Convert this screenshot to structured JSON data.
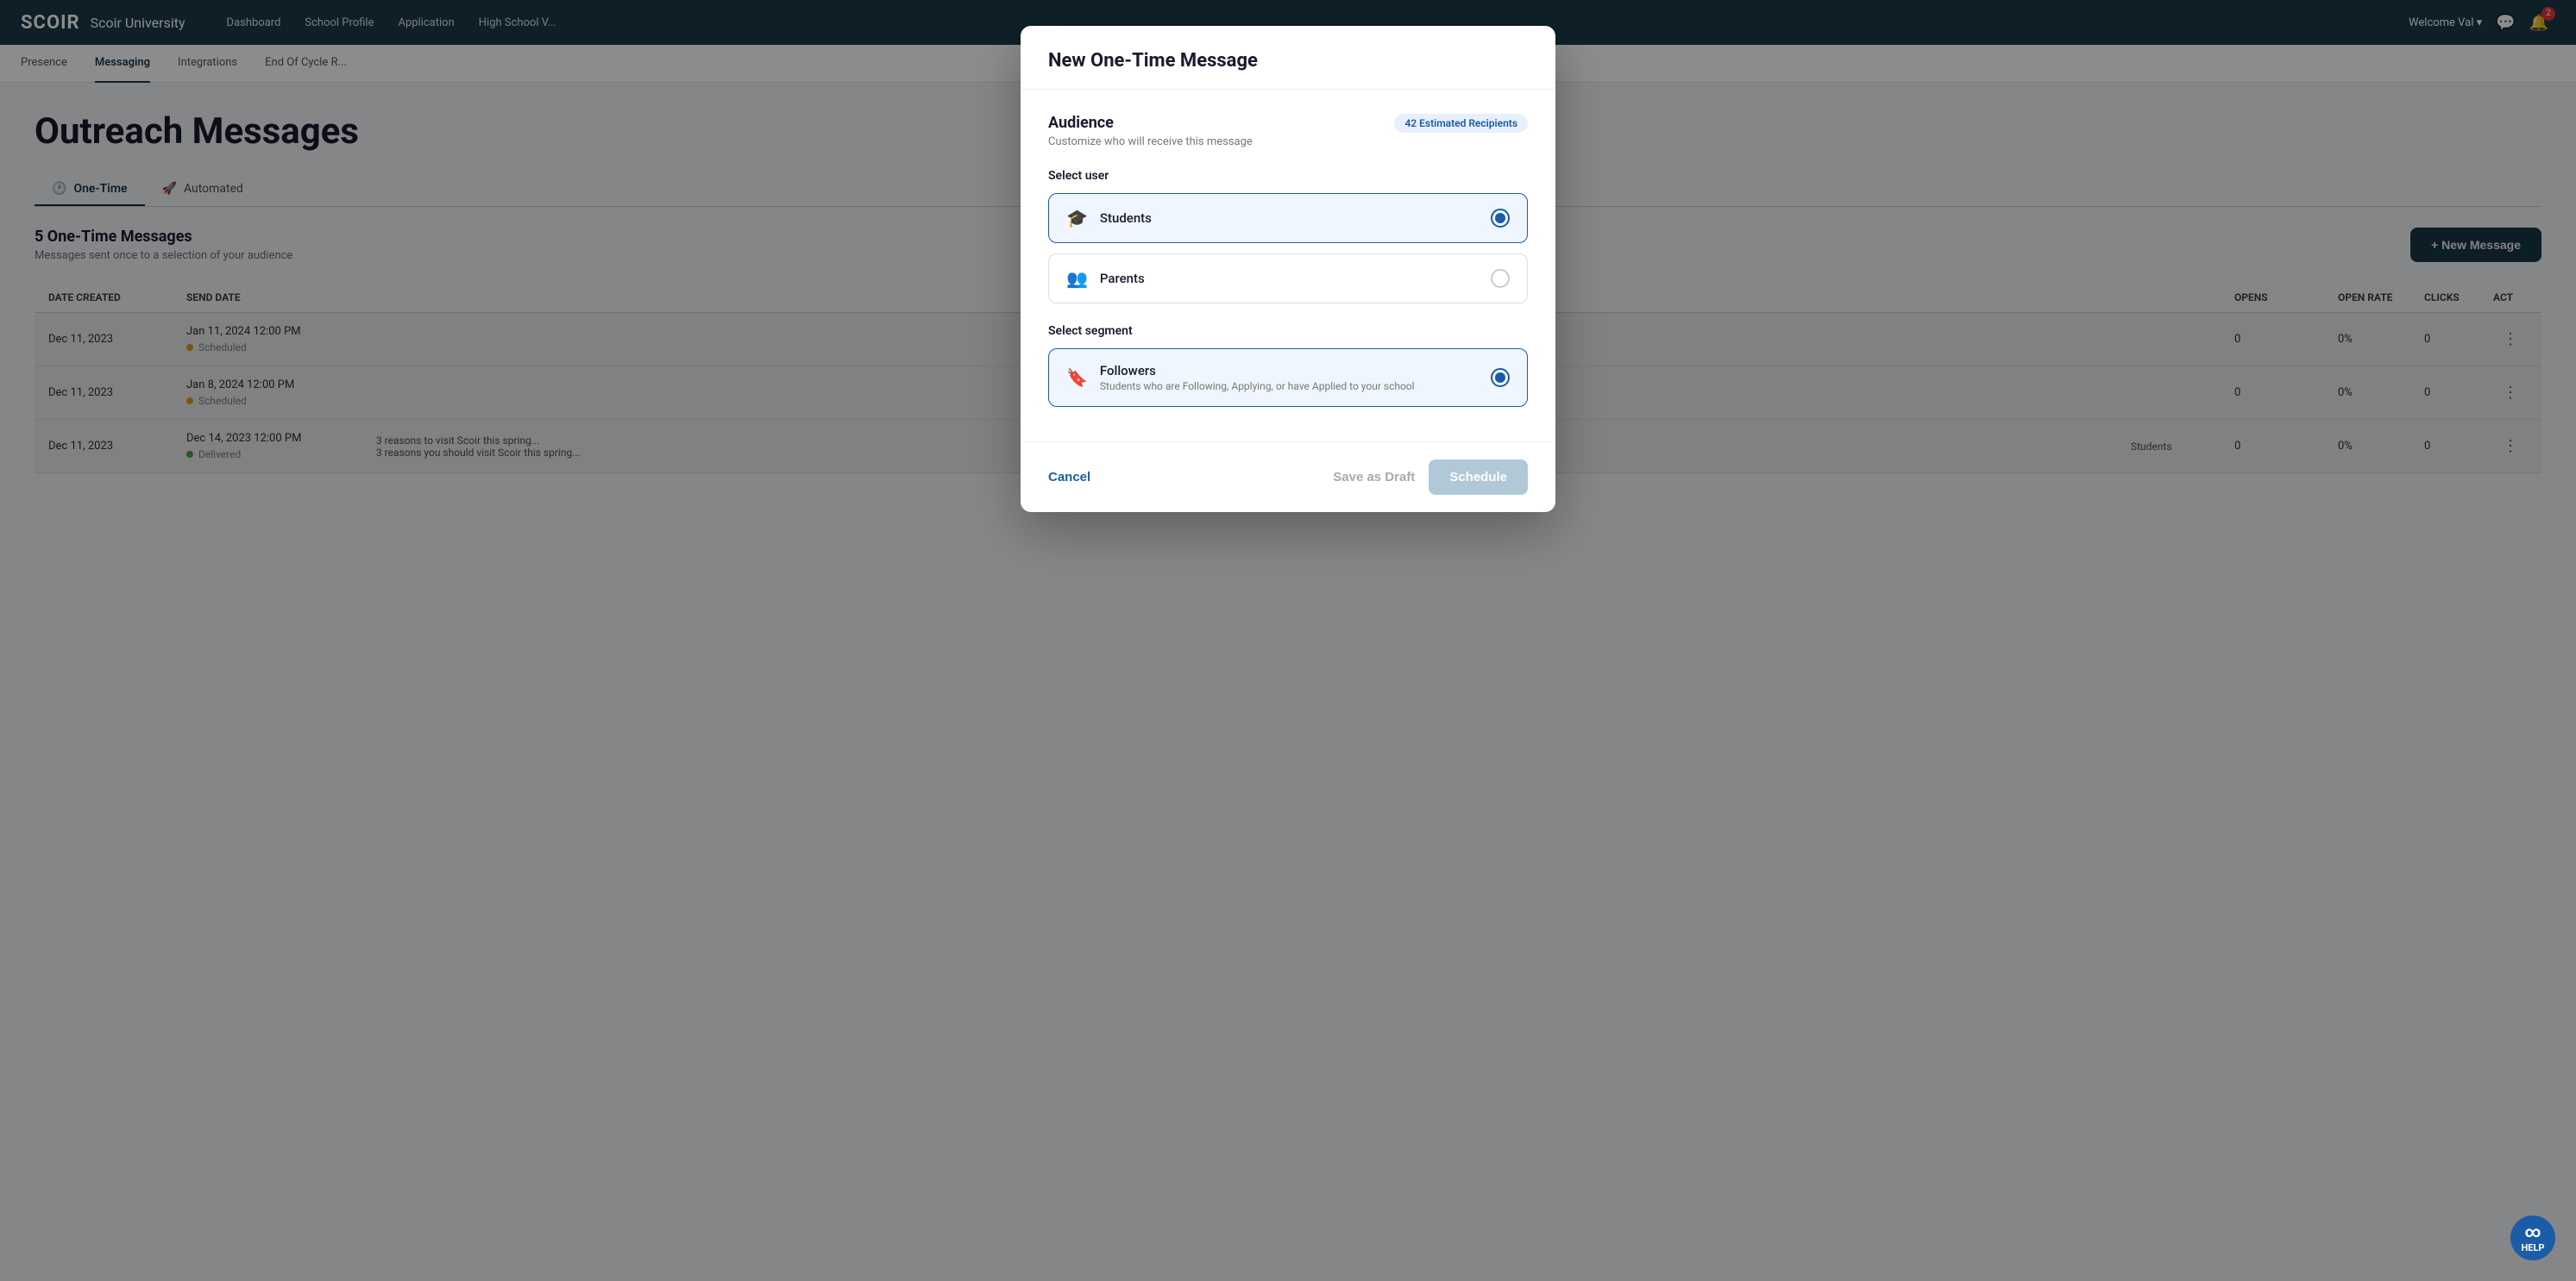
{
  "app": {
    "logo": "SCOIR",
    "school_name": "Scoir University"
  },
  "top_nav": {
    "links": [
      "Dashboard",
      "School Profile",
      "Application",
      "High School V..."
    ],
    "welcome": "Welcome Val ▾"
  },
  "secondary_nav": {
    "links": [
      "Presence",
      "Messaging",
      "Integrations",
      "End Of Cycle R..."
    ],
    "active": "Messaging"
  },
  "page": {
    "title": "Outreach Messages"
  },
  "tabs": [
    {
      "label": "One-Time",
      "icon": "🕐",
      "active": true
    },
    {
      "label": "Automated",
      "icon": "🚀",
      "active": false
    }
  ],
  "messages_section": {
    "count_title": "5 One-Time Messages",
    "subtitle": "Messages sent once to a selection of your audience",
    "new_message_btn": "+ New Message"
  },
  "table": {
    "headers": [
      "DATE CREATED",
      "SEND DATE",
      "",
      "",
      "OPENS",
      "OPEN RATE",
      "CLICKS",
      "ACT"
    ],
    "rows": [
      {
        "date_created": "Dec 11, 2023",
        "send_date": "Jan 11, 2024 12:00 PM",
        "status": "Scheduled",
        "status_type": "scheduled",
        "opens": "0",
        "open_rate": "0%",
        "clicks": "0"
      },
      {
        "date_created": "Dec 11, 2023",
        "send_date": "Jan 8, 2024 12:00 PM",
        "status": "Scheduled",
        "status_type": "scheduled",
        "opens": "0",
        "open_rate": "0%",
        "clicks": "0"
      },
      {
        "date_created": "Dec 11, 2023",
        "send_date": "Dec 14, 2023 12:00 PM",
        "status": "Delivered",
        "status_type": "delivered",
        "opens": "0",
        "open_rate": "0%",
        "clicks": "0"
      }
    ]
  },
  "modal": {
    "title": "New One-Time Message",
    "audience_title": "Audience",
    "audience_subtitle": "Customize who will receive this message",
    "recipients_badge": "42 Estimated Recipients",
    "select_user_label": "Select user",
    "user_options": [
      {
        "label": "Students",
        "icon": "🎓",
        "selected": true
      },
      {
        "label": "Parents",
        "icon": "👥",
        "selected": false
      }
    ],
    "select_segment_label": "Select segment",
    "segment_options": [
      {
        "label": "Followers",
        "sublabel": "Students who are Following, Applying, or have Applied to your school",
        "icon": "🔖",
        "selected": true
      }
    ],
    "cancel_btn": "Cancel",
    "draft_btn": "Save as Draft",
    "schedule_btn": "Schedule"
  },
  "help": {
    "label": "HELP"
  }
}
